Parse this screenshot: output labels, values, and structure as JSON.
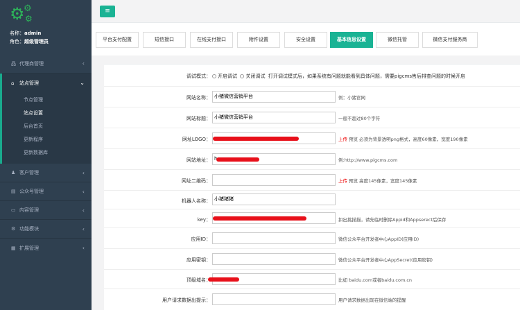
{
  "profile": {
    "name_label": "名称：",
    "name_value": "admin",
    "role_label": "角色：",
    "role_value": "超级管理员"
  },
  "sidebar": {
    "items": [
      {
        "label": "代理商管理",
        "icon": "sitemap-icon"
      },
      {
        "label": "站点管理",
        "icon": "home-icon"
      },
      {
        "label": "客户管理",
        "icon": "user-icon"
      },
      {
        "label": "公众号管理",
        "icon": "list-icon"
      },
      {
        "label": "内容管理",
        "icon": "card-icon"
      },
      {
        "label": "功能模块",
        "icon": "gear-icon"
      },
      {
        "label": "扩展管理",
        "icon": "grid-icon"
      }
    ],
    "sub_items": [
      "节点管理",
      "站点设置",
      "后台首页",
      "更新程序",
      "更新数据库"
    ]
  },
  "topbar": {
    "menu_icon": "≡"
  },
  "tabs": [
    "平台支付配置",
    "短信接口",
    "在线支付接口",
    "附件设置",
    "安全设置",
    "基本信息设置",
    "微信托管",
    "微信支付服务商"
  ],
  "active_tab": "基本信息设置",
  "form": {
    "debug": {
      "label": "调试模式：",
      "options": [
        "开启调试",
        "关闭调试"
      ],
      "desc": "打开调试模式后，如果系统有问题就能看到具体问题，需要pigcms售后排查问题的时候开启"
    },
    "site_name": {
      "label": "网站名称：",
      "value": "小猪微信营销平台",
      "hint": "例：小猪官网"
    },
    "site_title": {
      "label": "网站标题：",
      "value": "小猪微信营销平台",
      "hint": "一般不超过80个字符"
    },
    "site_logo": {
      "label": "网址LOGO：",
      "value": "",
      "upload": "上传",
      "hint": "预览  必须为背景透明png格式，高度60像素，宽度190像素"
    },
    "site_url": {
      "label": "网站地址：",
      "value": "h",
      "hint": "例:http://www.pigcms.com"
    },
    "site_qr": {
      "label": "网址二维码：",
      "value": "",
      "upload": "上传",
      "hint": "预览  高度145像素，宽度145像素"
    },
    "robot_name": {
      "label": "机器人名称：",
      "value": "小猪猪猪",
      "hint": ""
    },
    "key": {
      "label": "key：",
      "value": "",
      "hint": "扣出挑描描，请先临时删除Appid和Appserect后保存"
    },
    "app_id": {
      "label": "应用ID：",
      "value": "",
      "hint": "微信公众平台开发者中心AppID(应用ID)"
    },
    "app_secret": {
      "label": "应用密钥：",
      "value": "",
      "hint": "微信公众平台开发者中心AppSecret(应用密钥)"
    },
    "main_domain": {
      "label": "顶级域名：",
      "value": "",
      "hint": "比如 baidu.com或者baidu.com.cn"
    },
    "user_tip": {
      "label": "用户请求数据出提示：",
      "value": "",
      "hint": "用户请求数据出现在微信端的提醒"
    }
  },
  "colors": {
    "sidebar": "#2f4050",
    "accent": "#1ab394",
    "redaction": "#e8101a"
  }
}
